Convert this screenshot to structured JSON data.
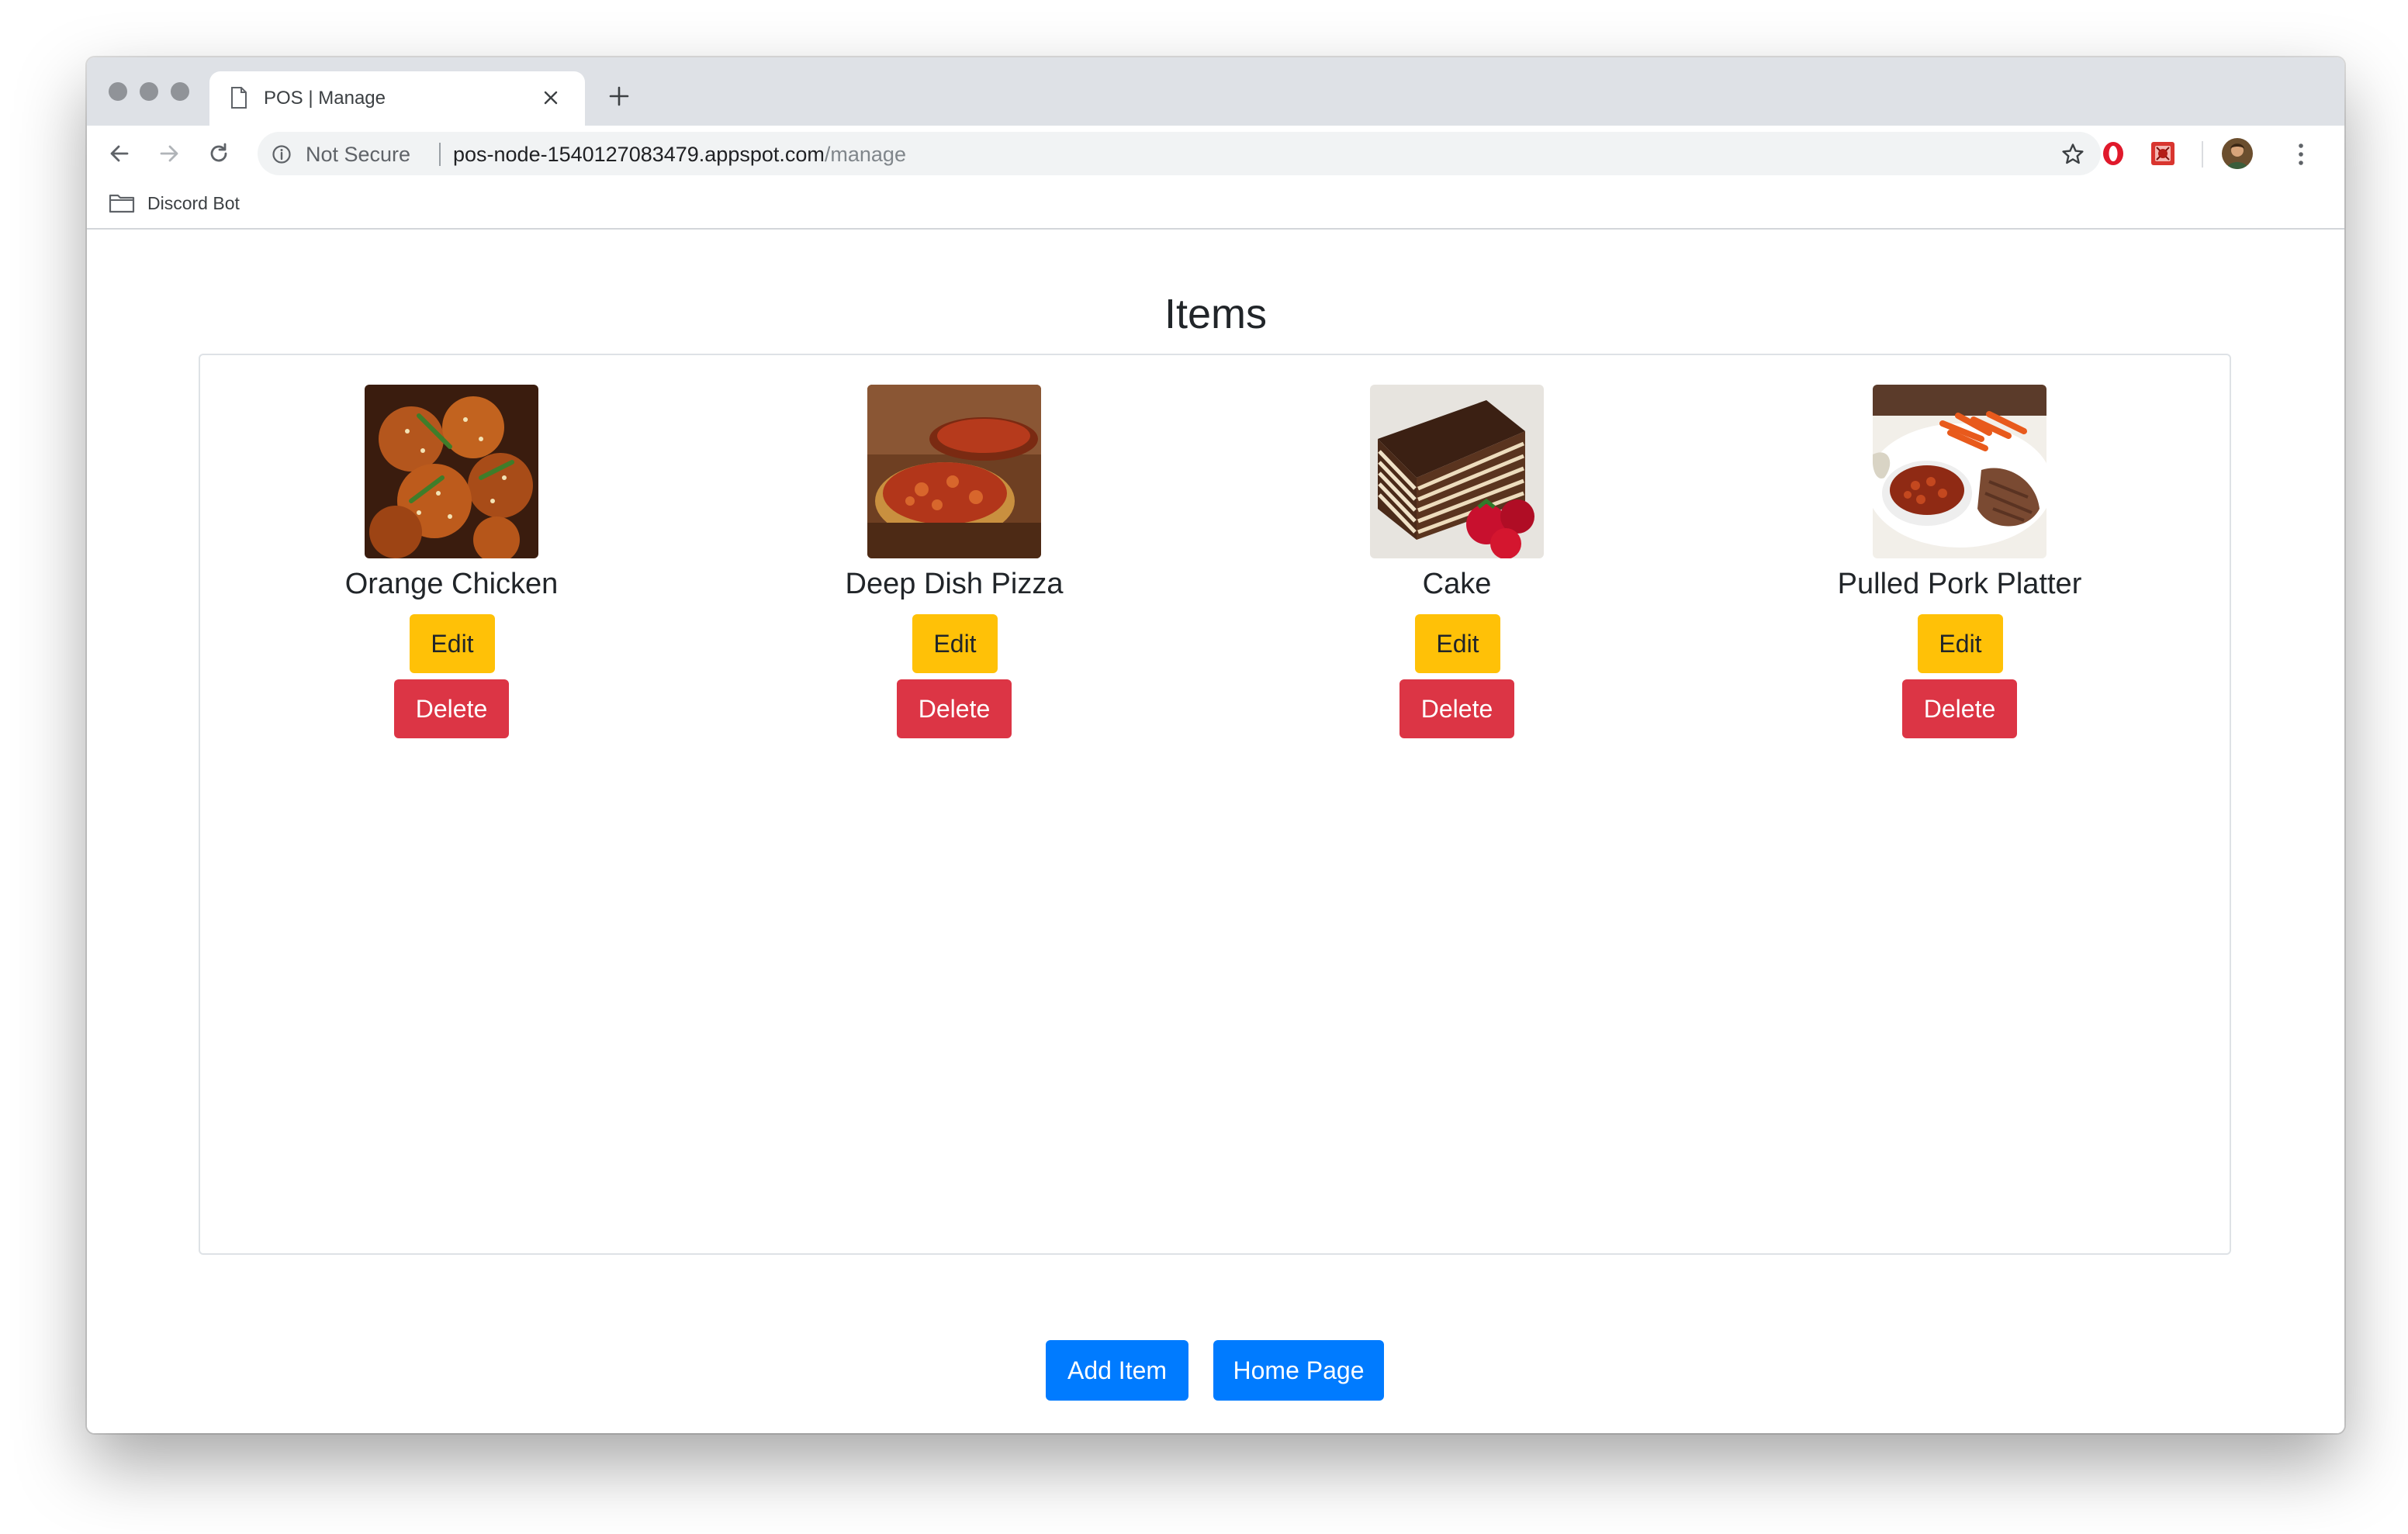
{
  "browser": {
    "tab_title": "POS | Manage",
    "security_label": "Not Secure",
    "url_host": "pos-node-1540127083479.appspot.com",
    "url_path": "/manage",
    "bookmarks": [
      {
        "label": "Discord Bot",
        "icon": "folder-icon"
      }
    ]
  },
  "page": {
    "title": "Items",
    "items": [
      {
        "name": "Orange Chicken",
        "edit_label": "Edit",
        "delete_label": "Delete"
      },
      {
        "name": "Deep Dish Pizza",
        "edit_label": "Edit",
        "delete_label": "Delete"
      },
      {
        "name": "Cake",
        "edit_label": "Edit",
        "delete_label": "Delete"
      },
      {
        "name": "Pulled Pork Platter",
        "edit_label": "Edit",
        "delete_label": "Delete"
      }
    ],
    "add_item_label": "Add Item",
    "home_page_label": "Home Page"
  },
  "colors": {
    "edit_button": "#ffc107",
    "delete_button": "#dc3545",
    "primary_button": "#007bff",
    "tabstrip": "#dee1e6"
  }
}
